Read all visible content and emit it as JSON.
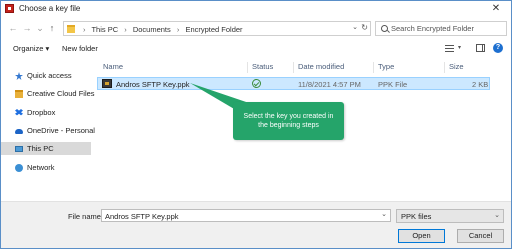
{
  "window": {
    "title": "Choose a key file",
    "close_glyph": "✕"
  },
  "nav": {
    "back": "←",
    "forward": "→",
    "recent": "⌄",
    "up": "↑"
  },
  "address": {
    "crumbs": [
      "This PC",
      "Documents",
      "Encrypted Folder"
    ],
    "separator": "›",
    "dropdown": "⌄",
    "refresh": "↻"
  },
  "search": {
    "placeholder": "Search Encrypted Folder"
  },
  "toolbar": {
    "organize": "Organize ▾",
    "new_folder": "New folder",
    "view_dd": "▾"
  },
  "sidebar": {
    "items": [
      {
        "label": "Quick access",
        "icon": "star-icon"
      },
      {
        "label": "Creative Cloud Files",
        "icon": "creative-cloud-folder-icon"
      },
      {
        "label": "Dropbox",
        "icon": "dropbox-icon"
      },
      {
        "label": "OneDrive - Personal",
        "icon": "onedrive-icon"
      },
      {
        "label": "This PC",
        "icon": "computer-icon",
        "selected": true
      },
      {
        "label": "Network",
        "icon": "network-icon"
      }
    ]
  },
  "columns": {
    "name": "Name",
    "status": "Status",
    "date": "Date modified",
    "type": "Type",
    "size": "Size"
  },
  "files": [
    {
      "name": "Andros SFTP Key.ppk",
      "date": "11/8/2021 4:57 PM",
      "type": "PPK File",
      "size": "2 KB"
    }
  ],
  "callout": {
    "line1": "Select the key you created in",
    "line2": "the beginning steps",
    "color": "#25a46a"
  },
  "footer": {
    "file_name_label": "File name:",
    "file_name_value": "Andros SFTP Key.ppk",
    "file_type": "PPK files",
    "dropdown": "⌄",
    "open": "Open",
    "cancel": "Cancel"
  }
}
